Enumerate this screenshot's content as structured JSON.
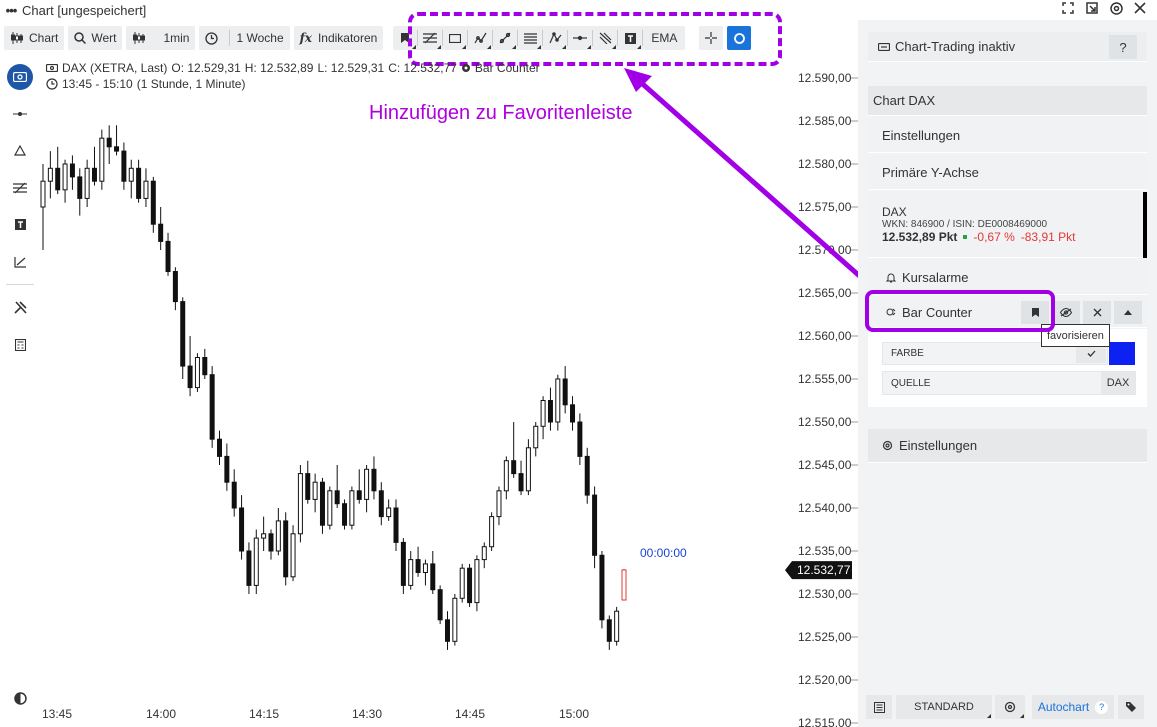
{
  "window": {
    "title": "Chart [ungespeichert]"
  },
  "toolbar": {
    "chart_label": "Chart",
    "value_label": "Wert",
    "interval_label": "1min",
    "range_label": "1 Woche",
    "indicators_label": "Indikatoren",
    "ema_label": "EMA"
  },
  "instrument": {
    "name": "DAX (XETRA, Last)",
    "open": "O: 12.529,31",
    "high": "H: 12.532,89",
    "low": "L: 12.529,31",
    "close": "C: 12.532,77",
    "indicator": "Bar Counter",
    "time_range": "13:45 - 15:10",
    "period": "(1 Stunde, 1 Minute)"
  },
  "annotation": {
    "text": "Hinzufügen zu Favoritenleiste"
  },
  "right_panel": {
    "trading_label": "Chart-Trading inaktiv",
    "help_label": "?",
    "section_title": "Chart DAX",
    "settings_label": "Einstellungen",
    "y_axis_label": "Primäre Y-Achse",
    "dax_name": "DAX",
    "dax_ids": "WKN: 846900 / ISIN: DE0008469000",
    "dax_price": "12.532,89 Pkt",
    "dax_change_pct": "-0,67 %",
    "dax_change_abs": "-83,91 Pkt",
    "alarms_label": "Kursalarme",
    "bar_counter_label": "Bar Counter",
    "tooltip": "favorisieren",
    "color_label": "FARBE",
    "source_label": "QUELLE",
    "source_value": "DAX",
    "settings2_label": "Einstellungen",
    "standard_label": "STANDARD",
    "autochart_label": "Autochart",
    "autochart_help": "?"
  },
  "colors": {
    "accent": "#1a73d9",
    "highlight": "#a100e6",
    "negative": "#e53935",
    "positive": "#2e9e44"
  },
  "chart_data": {
    "type": "candlestick",
    "y_ticks": [
      "12.590,00",
      "12.585,00",
      "12.580,00",
      "12.575,00",
      "12.570,00",
      "12.565,00",
      "12.560,00",
      "12.555,00",
      "12.550,00",
      "12.545,00",
      "12.540,00",
      "12.535,00",
      "12.530,00",
      "12.525,00",
      "12.520,00",
      "12.515,00"
    ],
    "x_ticks": [
      "13:45",
      "14:00",
      "14:15",
      "14:30",
      "14:45",
      "15:00"
    ],
    "ylim": [
      12515,
      12592
    ],
    "last_price_label": "12.532,77",
    "countdown": "00:00:00",
    "candles": [
      [
        12575.0,
        12580.0,
        12570.0,
        12578.0
      ],
      [
        12578.0,
        12581.5,
        12576.0,
        12579.5
      ],
      [
        12579.5,
        12582.0,
        12576.5,
        12577.0
      ],
      [
        12577.0,
        12580.5,
        12575.5,
        12580.0
      ],
      [
        12580.0,
        12581.0,
        12577.0,
        12578.5
      ],
      [
        12578.5,
        12579.5,
        12574.0,
        12576.0
      ],
      [
        12576.0,
        12580.5,
        12575.0,
        12579.5
      ],
      [
        12579.5,
        12582.0,
        12577.5,
        12578.0
      ],
      [
        12578.0,
        12584.0,
        12577.0,
        12583.0
      ],
      [
        12583.0,
        12584.5,
        12580.0,
        12582.0
      ],
      [
        12582.0,
        12584.5,
        12581.0,
        12581.5
      ],
      [
        12581.5,
        12582.5,
        12577.0,
        12578.0
      ],
      [
        12578.0,
        12580.5,
        12576.0,
        12579.5
      ],
      [
        12579.5,
        12580.5,
        12575.5,
        12576.0
      ],
      [
        12576.0,
        12579.5,
        12575.0,
        12578.0
      ],
      [
        12578.0,
        12578.5,
        12572.0,
        12573.0
      ],
      [
        12573.0,
        12575.0,
        12570.0,
        12571.0
      ],
      [
        12571.0,
        12572.0,
        12567.0,
        12567.5
      ],
      [
        12567.5,
        12568.0,
        12563.0,
        12564.0
      ],
      [
        12564.0,
        12564.5,
        12555.0,
        12556.5
      ],
      [
        12556.5,
        12560.0,
        12553.0,
        12554.0
      ],
      [
        12554.0,
        12558.0,
        12553.5,
        12557.5
      ],
      [
        12557.5,
        12558.5,
        12555.0,
        12555.5
      ],
      [
        12555.5,
        12556.5,
        12547.0,
        12548.0
      ],
      [
        12548.0,
        12549.0,
        12545.0,
        12546.0
      ],
      [
        12546.0,
        12547.5,
        12542.0,
        12543.0
      ],
      [
        12543.0,
        12544.5,
        12539.0,
        12540.0
      ],
      [
        12540.0,
        12541.5,
        12534.0,
        12535.0
      ],
      [
        12535.0,
        12536.0,
        12530.0,
        12531.0
      ],
      [
        12531.0,
        12537.5,
        12530.0,
        12536.5
      ],
      [
        12536.5,
        12539.0,
        12535.0,
        12537.0
      ],
      [
        12537.0,
        12537.5,
        12534.0,
        12535.0
      ],
      [
        12535.0,
        12540.0,
        12534.5,
        12538.5
      ],
      [
        12538.5,
        12539.5,
        12531.0,
        12532.0
      ],
      [
        12532.0,
        12538.0,
        12531.5,
        12537.0
      ],
      [
        12537.0,
        12545.0,
        12536.0,
        12544.0
      ],
      [
        12544.0,
        12545.5,
        12540.5,
        12541.0
      ],
      [
        12541.0,
        12544.0,
        12539.5,
        12543.0
      ],
      [
        12543.0,
        12543.5,
        12537.0,
        12538.0
      ],
      [
        12538.0,
        12542.5,
        12537.5,
        12542.0
      ],
      [
        12542.0,
        12545.0,
        12540.0,
        12540.5
      ],
      [
        12540.5,
        12541.0,
        12537.5,
        12538.0
      ],
      [
        12538.0,
        12542.5,
        12537.5,
        12542.0
      ],
      [
        12542.0,
        12544.5,
        12540.5,
        12541.0
      ],
      [
        12541.0,
        12545.0,
        12539.5,
        12544.5
      ],
      [
        12544.5,
        12546.0,
        12541.0,
        12542.0
      ],
      [
        12542.0,
        12543.0,
        12538.0,
        12539.0
      ],
      [
        12539.0,
        12541.0,
        12538.5,
        12540.0
      ],
      [
        12540.0,
        12541.0,
        12535.0,
        12536.0
      ],
      [
        12536.0,
        12536.5,
        12530.0,
        12531.0
      ],
      [
        12531.0,
        12535.0,
        12530.5,
        12534.0
      ],
      [
        12534.0,
        12535.5,
        12532.0,
        12532.5
      ],
      [
        12532.5,
        12534.0,
        12531.0,
        12533.5
      ],
      [
        12533.5,
        12535.0,
        12530.0,
        12530.5
      ],
      [
        12530.5,
        12531.0,
        12526.5,
        12527.0
      ],
      [
        12527.0,
        12528.0,
        12523.5,
        12524.5
      ],
      [
        12524.5,
        12530.0,
        12524.0,
        12529.5
      ],
      [
        12529.5,
        12533.5,
        12529.0,
        12533.0
      ],
      [
        12533.0,
        12533.5,
        12528.5,
        12529.0
      ],
      [
        12529.0,
        12534.5,
        12528.0,
        12534.0
      ],
      [
        12534.0,
        12536.0,
        12533.0,
        12535.5
      ],
      [
        12535.5,
        12539.5,
        12535.0,
        12539.0
      ],
      [
        12539.0,
        12542.5,
        12538.0,
        12542.0
      ],
      [
        12542.0,
        12546.0,
        12541.0,
        12545.5
      ],
      [
        12545.5,
        12550.0,
        12543.5,
        12544.0
      ],
      [
        12544.0,
        12545.5,
        12541.5,
        12542.0
      ],
      [
        12542.0,
        12548.0,
        12541.5,
        12547.0
      ],
      [
        12547.0,
        12550.0,
        12546.0,
        12549.5
      ],
      [
        12549.5,
        12553.0,
        12548.0,
        12552.5
      ],
      [
        12552.5,
        12554.0,
        12549.0,
        12550.0
      ],
      [
        12550.0,
        12555.5,
        12549.0,
        12555.0
      ],
      [
        12555.0,
        12556.5,
        12551.0,
        12552.0
      ],
      [
        12552.0,
        12553.0,
        12549.0,
        12550.0
      ],
      [
        12550.0,
        12551.0,
        12545.0,
        12546.0
      ],
      [
        12546.0,
        12547.0,
        12540.5,
        12541.5
      ],
      [
        12541.5,
        12542.5,
        12533.0,
        12534.5
      ],
      [
        12534.5,
        12535.0,
        12526.0,
        12527.0
      ],
      [
        12527.0,
        12527.5,
        12523.5,
        12524.5
      ],
      [
        12524.5,
        12528.5,
        12524.0,
        12528.0
      ],
      [
        12529.3,
        12532.9,
        12529.3,
        12532.8
      ]
    ]
  }
}
